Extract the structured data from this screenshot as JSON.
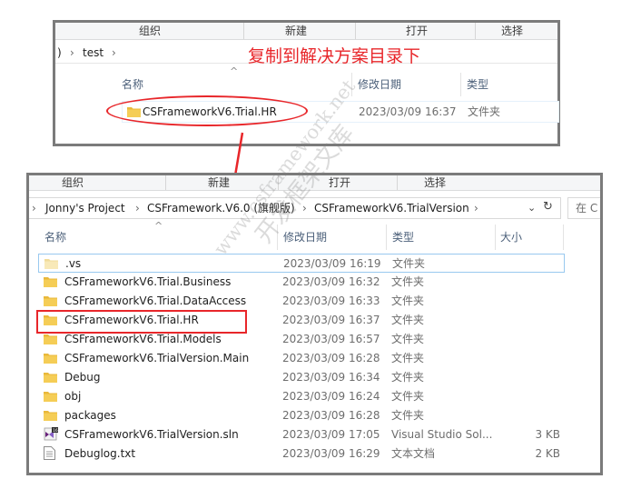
{
  "top_window": {
    "ribbon_groups": [
      "组织",
      "新建",
      "打开",
      "选择"
    ],
    "breadcrumb": [
      ")",
      "test"
    ],
    "annotation": "复制到解决方案目录下",
    "columns": {
      "name": "名称",
      "modified": "修改日期",
      "type": "类型"
    },
    "row": {
      "name": "CSFrameworkV6.Trial.HR",
      "modified": "2023/03/09 16:37",
      "type": "文件夹"
    }
  },
  "bottom_window": {
    "ribbon_groups": [
      "组织",
      "新建",
      "打开",
      "选择"
    ],
    "breadcrumb": [
      "Jonny's Project",
      "CSFramework.V6.0 (旗舰版)",
      "CSFrameworkV6.TrialVersion"
    ],
    "search_placeholder": "在 C",
    "columns": {
      "name": "名称",
      "modified": "修改日期",
      "type": "类型",
      "size": "大小"
    },
    "rows": [
      {
        "name": ".vs",
        "modified": "2023/03/09 16:19",
        "type": "文件夹",
        "size": "",
        "icon": "folder-light-icon"
      },
      {
        "name": "CSFrameworkV6.Trial.Business",
        "modified": "2023/03/09 16:32",
        "type": "文件夹",
        "size": "",
        "icon": "folder-icon"
      },
      {
        "name": "CSFrameworkV6.Trial.DataAccess",
        "modified": "2023/03/09 16:33",
        "type": "文件夹",
        "size": "",
        "icon": "folder-icon"
      },
      {
        "name": "CSFrameworkV6.Trial.HR",
        "modified": "2023/03/09 16:37",
        "type": "文件夹",
        "size": "",
        "icon": "folder-icon"
      },
      {
        "name": "CSFrameworkV6.Trial.Models",
        "modified": "2023/03/09 16:57",
        "type": "文件夹",
        "size": "",
        "icon": "folder-icon"
      },
      {
        "name": "CSFrameworkV6.TrialVersion.Main",
        "modified": "2023/03/09 16:28",
        "type": "文件夹",
        "size": "",
        "icon": "folder-icon"
      },
      {
        "name": "Debug",
        "modified": "2023/03/09 16:34",
        "type": "文件夹",
        "size": "",
        "icon": "folder-icon"
      },
      {
        "name": "obj",
        "modified": "2023/03/09 16:24",
        "type": "文件夹",
        "size": "",
        "icon": "folder-icon"
      },
      {
        "name": "packages",
        "modified": "2023/03/09 16:28",
        "type": "文件夹",
        "size": "",
        "icon": "folder-icon"
      },
      {
        "name": "CSFrameworkV6.TrialVersion.sln",
        "modified": "2023/03/09 17:05",
        "type": "Visual Studio Sol...",
        "size": "3 KB",
        "icon": "visual-studio-solution-icon"
      },
      {
        "name": "Debuglog.txt",
        "modified": "2023/03/09 16:29",
        "type": "文本文档",
        "size": "2 KB",
        "icon": "text-file-icon"
      }
    ]
  },
  "watermark": {
    "line1": "www.csframework.net",
    "line2": "开发框架文库"
  },
  "colors": {
    "annotation_red": "#e8262a",
    "frame_gray": "#7b7b7b",
    "folder_yellow": "#f0c24a",
    "selection_border": "#99c9ef"
  }
}
